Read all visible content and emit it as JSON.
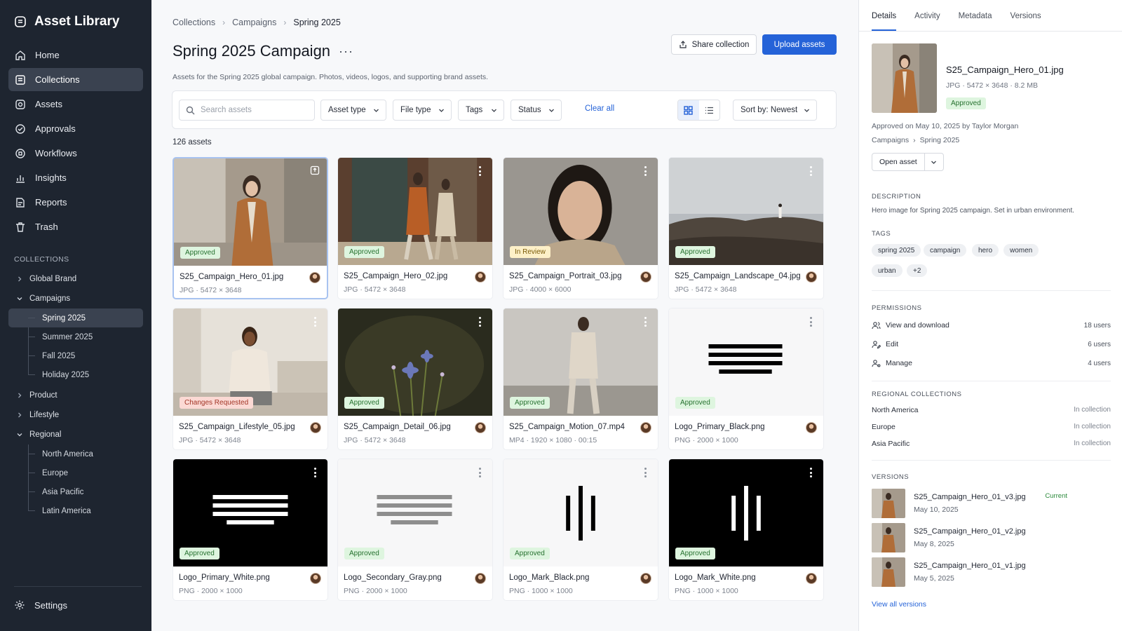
{
  "app": {
    "title": "Asset Library"
  },
  "sidebar": {
    "nav": [
      {
        "label": "Home",
        "icon": "home-icon"
      },
      {
        "label": "Collections",
        "icon": "collections-icon",
        "active": true
      },
      {
        "label": "Assets",
        "icon": "assets-icon"
      },
      {
        "label": "Approvals",
        "icon": "approvals-icon"
      },
      {
        "label": "Workflows",
        "icon": "workflows-icon"
      },
      {
        "label": "Insights",
        "icon": "insights-icon"
      },
      {
        "label": "Reports",
        "icon": "reports-icon"
      },
      {
        "label": "Trash",
        "icon": "trash-icon"
      }
    ],
    "collections_title": "COLLECTIONS",
    "tree": {
      "global_brand": "Global Brand",
      "campaigns": "Campaigns",
      "campaign_children": [
        "Spring 2025",
        "Summer 2025",
        "Fall 2025",
        "Holiday 2025"
      ],
      "product": "Product",
      "lifestyle": "Lifestyle",
      "regional": "Regional",
      "regional_children": [
        "North America",
        "Europe",
        "Asia Pacific",
        "Latin America"
      ]
    },
    "settings": "Settings"
  },
  "breadcrumb": [
    "Collections",
    "Campaigns",
    "Spring 2025"
  ],
  "page": {
    "title": "Spring 2025 Campaign",
    "description": "Assets for the Spring 2025 global campaign. Photos, videos, logos, and supporting brand assets.",
    "share_label": "Share collection",
    "upload_label": "Upload assets"
  },
  "filters": {
    "search_placeholder": "Search assets",
    "asset_type": "Asset type",
    "file_type": "File type",
    "tags": "Tags",
    "status": "Status",
    "clear": "Clear all",
    "sort": "Sort by: Newest",
    "view_mode": "grid"
  },
  "asset_count": "126 assets",
  "assets": [
    {
      "name": "S25_Campaign_Hero_01.jpg",
      "meta": "JPG · 5472 × 3648",
      "status": "Approved",
      "thumb": "hero01",
      "selected": true
    },
    {
      "name": "S25_Campaign_Hero_02.jpg",
      "meta": "JPG · 5472 × 3648",
      "status": "Approved",
      "thumb": "hero02"
    },
    {
      "name": "S25_Campaign_Portrait_03.jpg",
      "meta": "JPG · 4000 × 6000",
      "status": "In Review",
      "thumb": "portrait"
    },
    {
      "name": "S25_Campaign_Landscape_04.jpg",
      "meta": "JPG · 5472 × 3648",
      "status": "Approved",
      "thumb": "landscape"
    },
    {
      "name": "S25_Campaign_Lifestyle_05.jpg",
      "meta": "JPG · 5472 × 3648",
      "status": "Changes Requested",
      "thumb": "lifestyle"
    },
    {
      "name": "S25_Campaign_Detail_06.jpg",
      "meta": "JPG · 5472 × 3648",
      "status": "Approved",
      "thumb": "flower"
    },
    {
      "name": "S25_Campaign_Motion_07.mp4",
      "meta": "MP4 · 1920 × 1080 · 00:15",
      "status": "Approved",
      "thumb": "motion"
    },
    {
      "name": "Logo_Primary_Black.png",
      "meta": "PNG · 2000 × 1000",
      "status": "Approved",
      "thumb": "logo-black-on-white"
    },
    {
      "name": "Logo_Primary_White.png",
      "meta": "PNG · 2000 × 1000",
      "status": "Approved",
      "thumb": "logo-white-on-black"
    },
    {
      "name": "Logo_Secondary_Gray.png",
      "meta": "PNG · 2000 × 1000",
      "status": "Approved",
      "thumb": "logo-gray"
    },
    {
      "name": "Logo_Mark_Black.png",
      "meta": "PNG · 1000 × 1000",
      "status": "Approved",
      "thumb": "mark-black"
    },
    {
      "name": "Logo_Mark_White.png",
      "meta": "PNG · 1000 × 1000",
      "status": "Approved",
      "thumb": "mark-white"
    }
  ],
  "details": {
    "tabs": [
      "Details",
      "Activity",
      "Metadata",
      "Versions"
    ],
    "name": "S25_Campaign_Hero_01.jpg",
    "meta": "JPG · 5472 × 3648 · 8.2 MB",
    "status": "Approved",
    "approved_text": "Approved on May 10, 2025 by Taylor Morgan",
    "path": [
      "Campaigns",
      "Spring 2025"
    ],
    "open_label": "Open asset",
    "description_title": "DESCRIPTION",
    "description": "Hero image for Spring 2025 campaign. Set in urban environment.",
    "tags_title": "TAGS",
    "tags": [
      "spring 2025",
      "campaign",
      "hero",
      "women",
      "urban",
      "+2"
    ],
    "permissions_title": "PERMISSIONS",
    "permissions": [
      {
        "label": "View and download",
        "value": "18 users"
      },
      {
        "label": "Edit",
        "value": "6 users"
      },
      {
        "label": "Manage",
        "value": "4 users"
      }
    ],
    "regional_title": "REGIONAL COLLECTIONS",
    "regional": [
      {
        "label": "North America",
        "value": "In collection"
      },
      {
        "label": "Europe",
        "value": "In collection"
      },
      {
        "label": "Asia Pacific",
        "value": "In collection"
      }
    ],
    "versions_title": "VERSIONS",
    "versions": [
      {
        "name": "S25_Campaign_Hero_01_v3.jpg",
        "date": "May 10, 2025",
        "current": "Current"
      },
      {
        "name": "S25_Campaign_Hero_01_v2.jpg",
        "date": "May 8, 2025"
      },
      {
        "name": "S25_Campaign_Hero_01_v1.jpg",
        "date": "May 5, 2025"
      }
    ],
    "view_all": "View all versions"
  },
  "colors": {
    "accent": "#2563d8",
    "sidebar": "#1e2530",
    "approved": "#26712f"
  }
}
